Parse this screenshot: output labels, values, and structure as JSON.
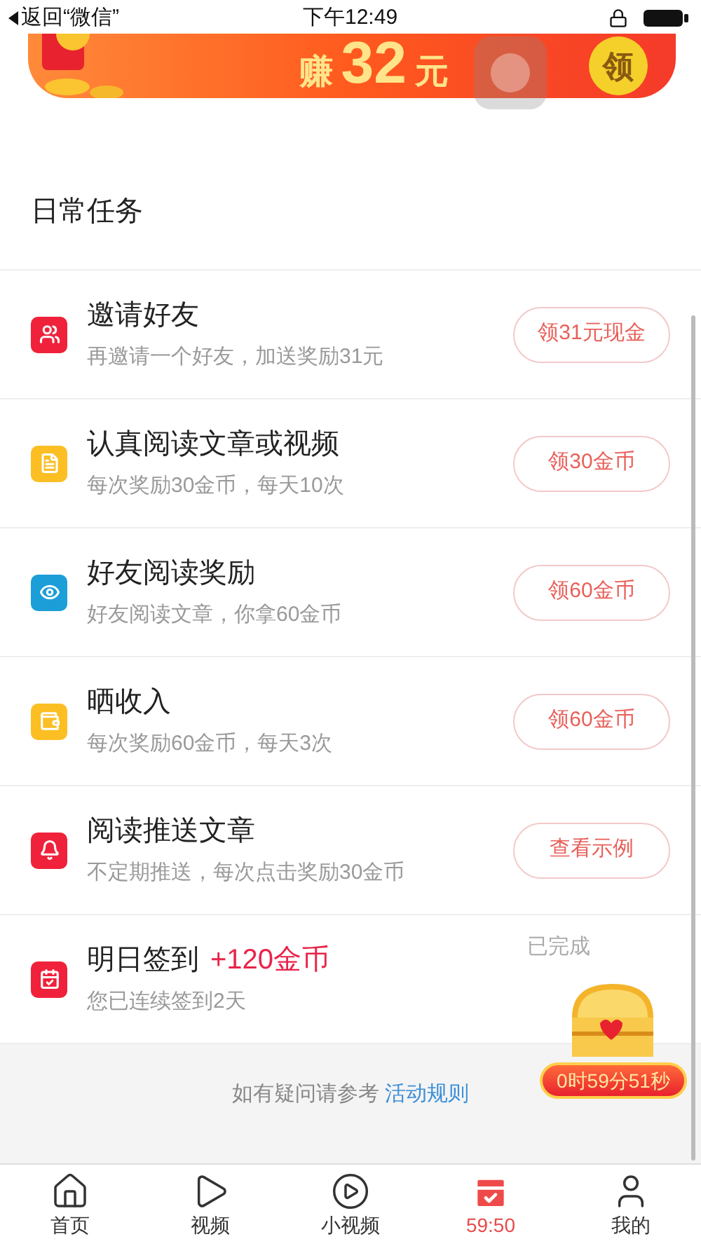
{
  "status_bar": {
    "back": "返回“微信”",
    "time": "下午12:49"
  },
  "banner": {
    "text": "赚",
    "amount": "32",
    "unit": "元",
    "coin": "领"
  },
  "section_title": "日常任务",
  "tasks": [
    {
      "kind": "button",
      "color": "#f0213a",
      "title": "邀请好友",
      "subtitle": "再邀请一个好友，加送奖励31元",
      "action": "领31元现金"
    },
    {
      "kind": "button",
      "color": "#fbbf24",
      "title": "认真阅读文章或视频",
      "subtitle": "每次奖励30金币，每天10次",
      "action": "领30金币"
    },
    {
      "kind": "button",
      "color": "#1c9ed8",
      "title": "好友阅读奖励",
      "subtitle": "好友阅读文章，你拿60金币",
      "action": "领60金币"
    },
    {
      "kind": "button",
      "color": "#fbbf24",
      "title": "晒收入",
      "subtitle": "每次奖励60金币，每天3次",
      "action": "领60金币"
    },
    {
      "kind": "button",
      "color": "#f0213a",
      "title": "阅读推送文章",
      "subtitle": "不定期推送，每次点击奖励30金币",
      "action": "查看示例"
    },
    {
      "kind": "status",
      "color": "#f0213a",
      "title": "明日签到",
      "bonus": "+120金币",
      "subtitle": "您已连续签到2天",
      "status": "已完成"
    }
  ],
  "chest": {
    "timer": "0时59分51秒"
  },
  "footer": {
    "text": "如有疑问请参考",
    "link": "活动规则"
  },
  "nav": [
    {
      "label": "首页",
      "selected": false
    },
    {
      "label": "视频",
      "selected": false
    },
    {
      "label": "小视频",
      "selected": false
    },
    {
      "label": "59:50",
      "selected": true
    },
    {
      "label": "我的",
      "selected": false
    }
  ]
}
